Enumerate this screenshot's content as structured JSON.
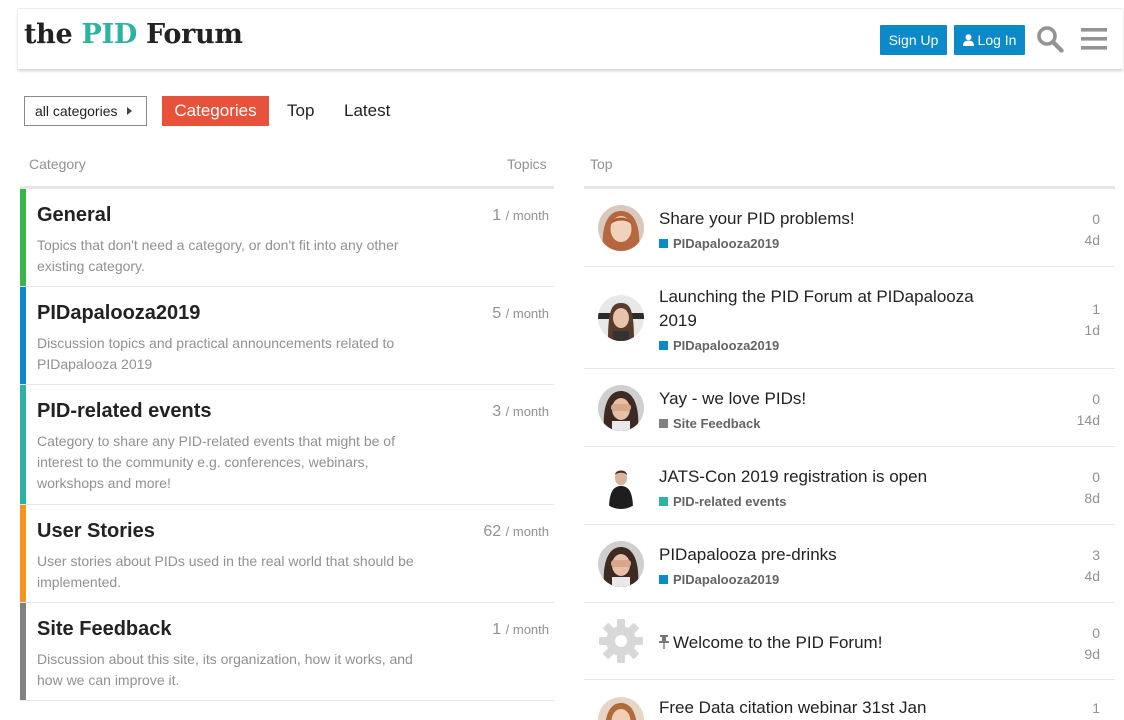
{
  "header": {
    "logo_prefix": "the ",
    "logo_accent": "PID",
    "logo_suffix": " Forum",
    "signup_label": "Sign Up",
    "login_label": "Log In",
    "search_icon": "search-icon",
    "menu_icon": "hamburger-menu-icon"
  },
  "nav": {
    "category_dropdown": "all categories",
    "tabs": [
      {
        "label": "Categories",
        "active": true
      },
      {
        "label": "Top",
        "active": false
      },
      {
        "label": "Latest",
        "active": false
      }
    ]
  },
  "categories_table": {
    "col_category": "Category",
    "col_topics": "Topics",
    "unit": "/ month",
    "rows": [
      {
        "name": "General",
        "description": "Topics that don't need a category, or don't fit into any other existing category.",
        "count": "1",
        "color": "#3ab54a"
      },
      {
        "name": "PIDapalooza2019",
        "description": "Discussion topics and practical announcements related to PIDapalooza 2019",
        "count": "5",
        "color": "#0b89c8"
      },
      {
        "name": "PID-related events",
        "description": "Category to share any PID-related events that might be of interest to the community e.g. conferences, webinars, workshops and more!",
        "count": "3",
        "color": "#2cb3a4"
      },
      {
        "name": "User Stories",
        "description": "User stories about PIDs used in the real world that should be implemented.",
        "count": "62",
        "color": "#f7941d"
      },
      {
        "name": "Site Feedback",
        "description": "Discussion about this site, its organization, how it works, and how we can improve it.",
        "count": "1",
        "color": "#808281"
      }
    ]
  },
  "top_list": {
    "col_top": "Top",
    "topics": [
      {
        "title": "Share your PID problems!",
        "category": "PIDapalooza2019",
        "cat_color": "#0b89c8",
        "replies": "0",
        "age": "4d"
      },
      {
        "title": "Launching the PID Forum at PIDapalooza 2019",
        "category": "PIDapalooza2019",
        "cat_color": "#0b89c8",
        "replies": "1",
        "age": "1d"
      },
      {
        "title": "Yay - we love PIDs!",
        "category": "Site Feedback",
        "cat_color": "#808281",
        "replies": "0",
        "age": "14d"
      },
      {
        "title": "JATS-Con 2019 registration is open",
        "category": "PID-related events",
        "cat_color": "#2cb3a4",
        "replies": "0",
        "age": "8d"
      },
      {
        "title": "PIDapalooza pre-drinks",
        "category": "PIDapalooza2019",
        "cat_color": "#0b89c8",
        "replies": "3",
        "age": "4d"
      },
      {
        "title": "Welcome to the PID Forum!",
        "category": "",
        "cat_color": "",
        "replies": "0",
        "age": "9d",
        "pinned": true
      },
      {
        "title": "Free Data citation webinar 31st Jan",
        "category": "",
        "cat_color": "",
        "replies": "1",
        "age": ""
      }
    ]
  }
}
